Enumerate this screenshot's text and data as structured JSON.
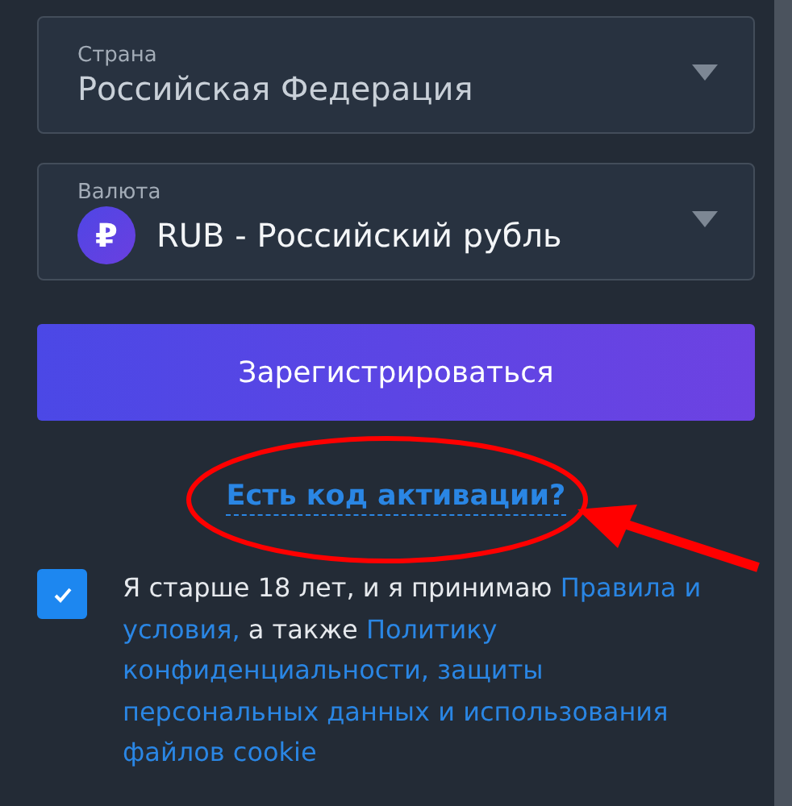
{
  "fields": [
    {
      "label": "Страна",
      "value": "Российская Федерация",
      "kind": "select"
    },
    {
      "label": "Валюта",
      "value": "RUB - Российский рубль",
      "kind": "currency",
      "icon_text": "₽"
    }
  ],
  "submit_button": "Зарегистрироваться",
  "activation_link": "Есть код активации?",
  "agreement": {
    "checked": true,
    "parts": [
      {
        "kind": "text",
        "text": "Я старше 18 лет, и я принимаю "
      },
      {
        "kind": "link",
        "text": "Правила и условия,"
      },
      {
        "kind": "text",
        "text": " а также "
      },
      {
        "kind": "link",
        "text": "Политику конфиденциальности, защиты персональных данных и использования файлов cookie"
      }
    ]
  }
}
